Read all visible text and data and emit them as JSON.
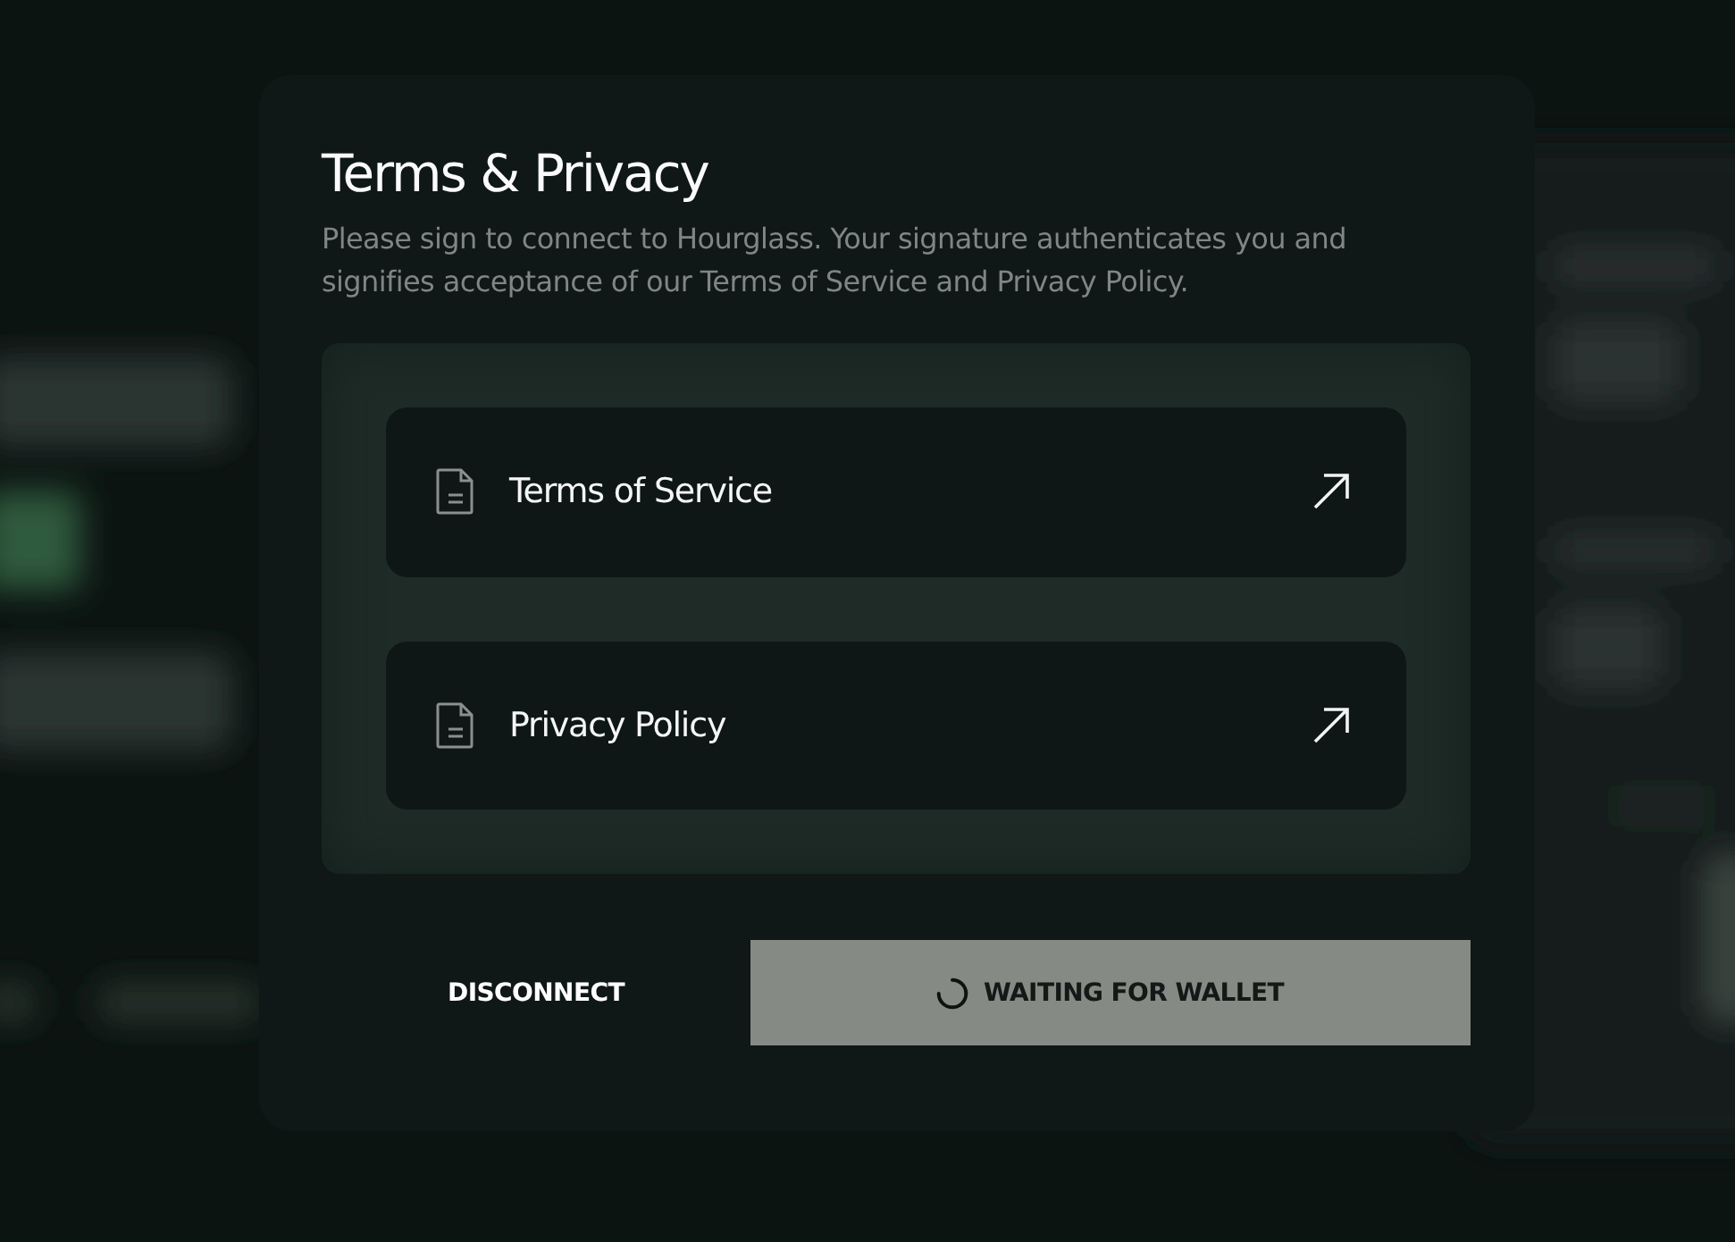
{
  "dialog": {
    "title": "Terms & Privacy",
    "description": "Please sign to connect to Hourglass. Your signature authenticates you and signifies acceptance of our Terms of Service and Privacy Policy.",
    "links": [
      {
        "label": "Terms of Service"
      },
      {
        "label": "Privacy Policy"
      }
    ],
    "secondary_button": {
      "label": "DISCONNECT"
    },
    "primary_button": {
      "label": "WAITING FOR WALLET",
      "loading": true
    }
  }
}
